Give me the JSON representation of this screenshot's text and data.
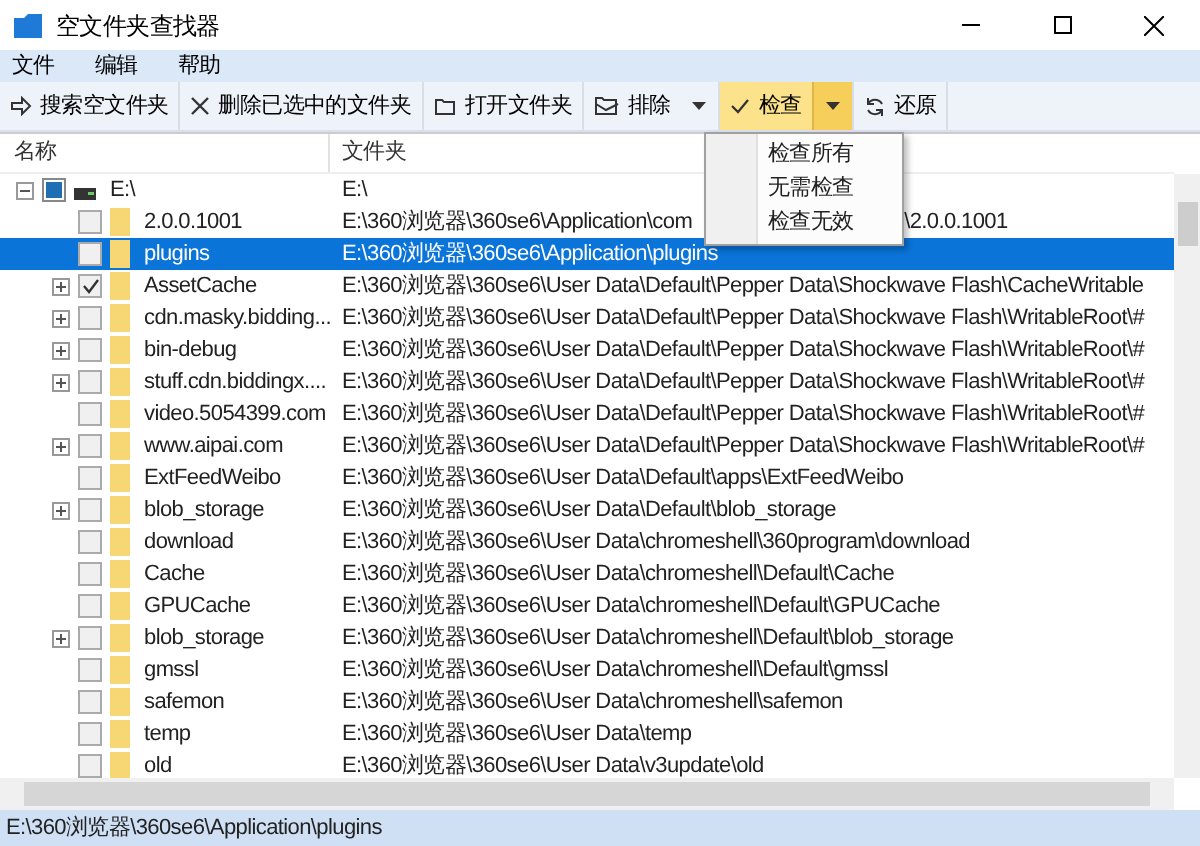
{
  "window": {
    "title": "空文件夹查找器"
  },
  "menu_bar": [
    "文件",
    "编辑",
    "帮助"
  ],
  "toolbar": [
    {
      "kind": "search",
      "label": "搜索空文件夹",
      "dropdown": false,
      "pressed": false
    },
    {
      "kind": "delete",
      "label": "删除已选中的文件夹",
      "dropdown": false,
      "pressed": false
    },
    {
      "kind": "open",
      "label": "打开文件夹",
      "dropdown": false,
      "pressed": false
    },
    {
      "kind": "exclude",
      "label": "排除",
      "dropdown": true,
      "pressed": false
    },
    {
      "kind": "check",
      "label": "检查",
      "dropdown": true,
      "pressed": true
    },
    {
      "kind": "restore",
      "label": "还原",
      "dropdown": false,
      "pressed": false
    }
  ],
  "dropdown_menu": [
    "检查所有",
    "无需检查",
    "检查无效"
  ],
  "table": {
    "columns": [
      "名称",
      "文件夹"
    ],
    "tree": [
      {
        "name": "E:\\",
        "folder": "E:\\",
        "kind": "drive",
        "indeterminate": true,
        "has_children": true,
        "expanded": true,
        "selected": false,
        "children": [
          {
            "name": "2.0.0.1001",
            "folder": "E:\\360浏览器\\360se6\\Application\\com",
            "folder_tail": "\\2.0.0.1001",
            "checked": false,
            "has_children": false,
            "selected": false
          },
          {
            "name": "plugins",
            "folder": "E:\\360浏览器\\360se6\\Application\\plugins",
            "checked": false,
            "has_children": false,
            "selected": true
          },
          {
            "name": "AssetCache",
            "folder": "E:\\360浏览器\\360se6\\User Data\\Default\\Pepper Data\\Shockwave Flash\\CacheWritable",
            "checked": true,
            "has_children": true,
            "selected": false
          },
          {
            "name": "cdn.masky.bidding...",
            "folder": "E:\\360浏览器\\360se6\\User Data\\Default\\Pepper Data\\Shockwave Flash\\WritableRoot\\#",
            "checked": false,
            "has_children": true,
            "selected": false
          },
          {
            "name": "bin-debug",
            "folder": "E:\\360浏览器\\360se6\\User Data\\Default\\Pepper Data\\Shockwave Flash\\WritableRoot\\#",
            "checked": false,
            "has_children": true,
            "selected": false
          },
          {
            "name": "stuff.cdn.biddingx....",
            "folder": "E:\\360浏览器\\360se6\\User Data\\Default\\Pepper Data\\Shockwave Flash\\WritableRoot\\#",
            "checked": false,
            "has_children": true,
            "selected": false
          },
          {
            "name": "video.5054399.com",
            "folder": "E:\\360浏览器\\360se6\\User Data\\Default\\Pepper Data\\Shockwave Flash\\WritableRoot\\#",
            "checked": false,
            "has_children": false,
            "selected": false
          },
          {
            "name": "www.aipai.com",
            "folder": "E:\\360浏览器\\360se6\\User Data\\Default\\Pepper Data\\Shockwave Flash\\WritableRoot\\#",
            "checked": false,
            "has_children": true,
            "selected": false
          },
          {
            "name": "ExtFeedWeibo",
            "folder": "E:\\360浏览器\\360se6\\User Data\\Default\\apps\\ExtFeedWeibo",
            "checked": false,
            "has_children": false,
            "selected": false
          },
          {
            "name": "blob_storage",
            "folder": "E:\\360浏览器\\360se6\\User Data\\Default\\blob_storage",
            "checked": false,
            "has_children": true,
            "selected": false
          },
          {
            "name": "download",
            "folder": "E:\\360浏览器\\360se6\\User Data\\chromeshell\\360program\\download",
            "checked": false,
            "has_children": false,
            "selected": false
          },
          {
            "name": "Cache",
            "folder": "E:\\360浏览器\\360se6\\User Data\\chromeshell\\Default\\Cache",
            "checked": false,
            "has_children": false,
            "selected": false
          },
          {
            "name": "GPUCache",
            "folder": "E:\\360浏览器\\360se6\\User Data\\chromeshell\\Default\\GPUCache",
            "checked": false,
            "has_children": false,
            "selected": false
          },
          {
            "name": "blob_storage",
            "folder": "E:\\360浏览器\\360se6\\User Data\\chromeshell\\Default\\blob_storage",
            "checked": false,
            "has_children": true,
            "selected": false
          },
          {
            "name": "gmssl",
            "folder": "E:\\360浏览器\\360se6\\User Data\\chromeshell\\Default\\gmssl",
            "checked": false,
            "has_children": false,
            "selected": false
          },
          {
            "name": "safemon",
            "folder": "E:\\360浏览器\\360se6\\User Data\\chromeshell\\safemon",
            "checked": false,
            "has_children": false,
            "selected": false
          },
          {
            "name": "temp",
            "folder": "E:\\360浏览器\\360se6\\User Data\\temp",
            "checked": false,
            "has_children": false,
            "selected": false
          },
          {
            "name": "old",
            "folder": "E:\\360浏览器\\360se6\\User Data\\v3update\\old",
            "checked": false,
            "has_children": false,
            "selected": false
          }
        ]
      }
    ]
  },
  "status_bar": "E:\\360浏览器\\360se6\\Application\\plugins"
}
